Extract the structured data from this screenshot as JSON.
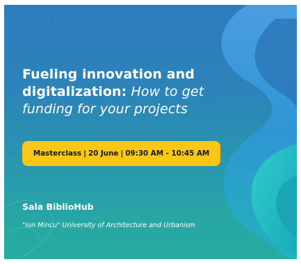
{
  "event": {
    "headline_bold": "Fueling innovation and digitalization:",
    "headline_italic": "How to get funding for your projects",
    "pill": {
      "type": "Masterclass",
      "date": "20 June",
      "time": "09:30 AM - 10:45 AM",
      "separator": "|"
    },
    "venue": "Sala BiblioHub",
    "university": "\"Ion Mincu\" University of Architecture and Urbanism"
  },
  "colors": {
    "background_top": "#2d7bbd",
    "background_bottom": "#26ac9f",
    "accent_pill": "#f9c816",
    "text": "#ffffff"
  },
  "decorations": [
    "ribbon-wave-shape",
    "dotted-pattern",
    "outline-pin-shape"
  ]
}
